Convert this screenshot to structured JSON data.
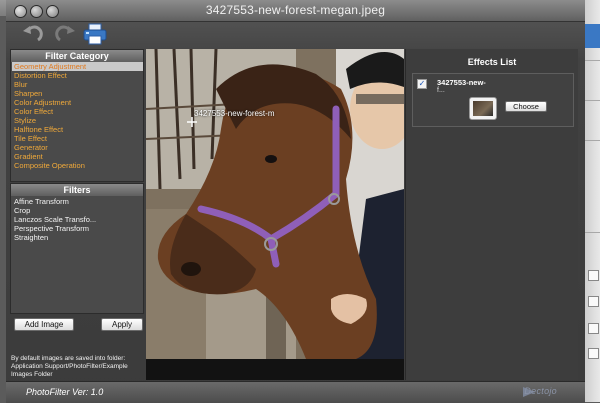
{
  "window": {
    "title": "3427553-new-forest-megan.jpeg"
  },
  "filter_category": {
    "heading": "Filter Category",
    "items": [
      {
        "label": "Geometry Adjustment",
        "selected": true
      },
      {
        "label": "Distortion Effect",
        "selected": false
      },
      {
        "label": "Blur",
        "selected": false
      },
      {
        "label": "Sharpen",
        "selected": false
      },
      {
        "label": "Color Adjustment",
        "selected": false
      },
      {
        "label": "Color Effect",
        "selected": false
      },
      {
        "label": "Stylize",
        "selected": false
      },
      {
        "label": "Halftone Effect",
        "selected": false
      },
      {
        "label": "Tile Effect",
        "selected": false
      },
      {
        "label": "Generator",
        "selected": false
      },
      {
        "label": "Gradient",
        "selected": false
      },
      {
        "label": "Composite Operation",
        "selected": false
      }
    ]
  },
  "filters": {
    "heading": "Filters",
    "items": [
      {
        "label": "Affine Transform"
      },
      {
        "label": "Crop"
      },
      {
        "label": "Lanczos Scale Transfo..."
      },
      {
        "label": "Perspective Transform"
      },
      {
        "label": "Straighten"
      }
    ]
  },
  "buttons": {
    "add_image": "Add Image",
    "apply": "Apply"
  },
  "save_note": [
    "By default images are saved into folder:",
    "Application Support/PhotoFilter/Example",
    "Images Folder"
  ],
  "preview": {
    "caption": "3427553-new-forest-m"
  },
  "effects_list": {
    "heading": "Effects List",
    "item": {
      "name": "3427553-new-",
      "name_line2": "f...",
      "checked": true,
      "choose_label": "Choose"
    }
  },
  "footer": {
    "version": "PhotoFilter Ver: 1.0",
    "brand": "Dectojo"
  },
  "icons": {
    "undo": "undo-icon",
    "redo": "redo-icon",
    "print": "print-icon",
    "crosshair": "crosshair-icon"
  },
  "colors": {
    "category_text": "#f0a93a",
    "selected_bg": "#c9c9c9",
    "accent_blue": "#3a78c4"
  }
}
